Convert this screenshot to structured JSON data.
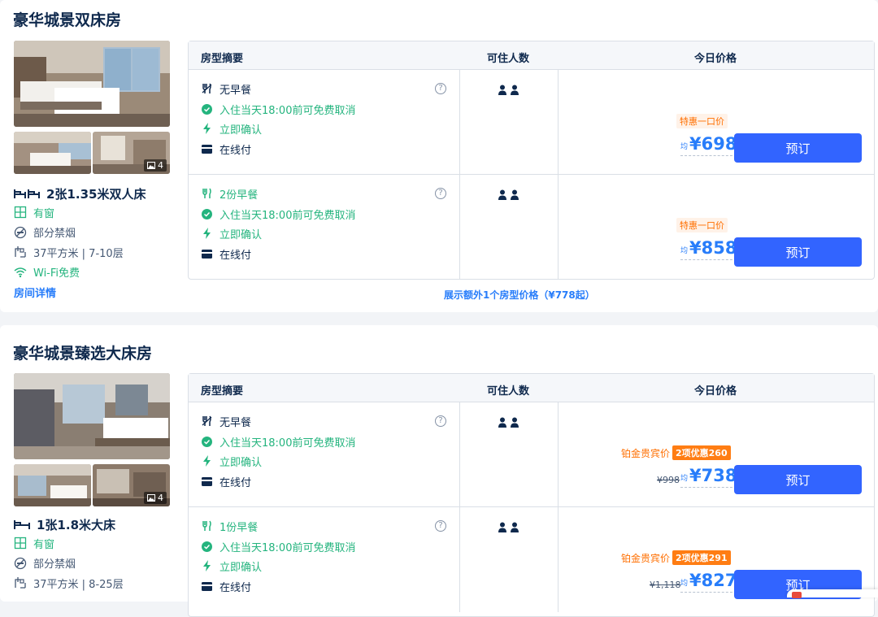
{
  "colors": {
    "primary": "#287dfa",
    "button": "#3264ff",
    "promo": "#ff6f00",
    "green": "#24b47e",
    "text": "#0f294d"
  },
  "headers": {
    "summary": "房型摘要",
    "guests": "可住人数",
    "price": "今日价格"
  },
  "rooms": [
    {
      "title": "豪华城景双床房",
      "photo_count": "4",
      "bed": "2张1.35米双人床",
      "facts": {
        "window": "有窗",
        "smoking": "部分禁烟",
        "area": "37平方米 | 7-10层",
        "wifi": "Wi-Fi免费"
      },
      "detail_link": "房间详情",
      "rates": [
        {
          "meal": "无早餐",
          "cancel": "入住当天18:00前可免费取消",
          "confirm": "立即确认",
          "pay": "在线付",
          "promo": "特惠一口价",
          "avg": "均",
          "price": "¥698",
          "book": "预订"
        },
        {
          "meal": "2份早餐",
          "cancel": "入住当天18:00前可免费取消",
          "confirm": "立即确认",
          "pay": "在线付",
          "promo": "特惠一口价",
          "avg": "均",
          "price": "¥858",
          "book": "预订"
        }
      ],
      "more_link": "展示额外1个房型价格（¥778起）"
    },
    {
      "title": "豪华城景臻选大床房",
      "photo_count": "4",
      "bed": "1张1.8米大床",
      "facts": {
        "window": "有窗",
        "smoking": "部分禁烟",
        "area": "37平方米 | 8-25层"
      },
      "rates": [
        {
          "meal": "无早餐",
          "cancel": "入住当天18:00前可免费取消",
          "confirm": "立即确认",
          "pay": "在线付",
          "member": "铂金贵宾价",
          "discount": "2项优惠260",
          "old_price": "¥998",
          "avg": "均",
          "price": "¥738",
          "book": "预订"
        },
        {
          "meal": "1份早餐",
          "cancel": "入住当天18:00前可免费取消",
          "confirm": "立即确认",
          "pay": "在线付",
          "member": "铂金贵宾价",
          "discount": "2项优惠291",
          "old_price": "¥1,118",
          "avg": "均",
          "price": "¥827",
          "book": "预订"
        }
      ]
    }
  ]
}
